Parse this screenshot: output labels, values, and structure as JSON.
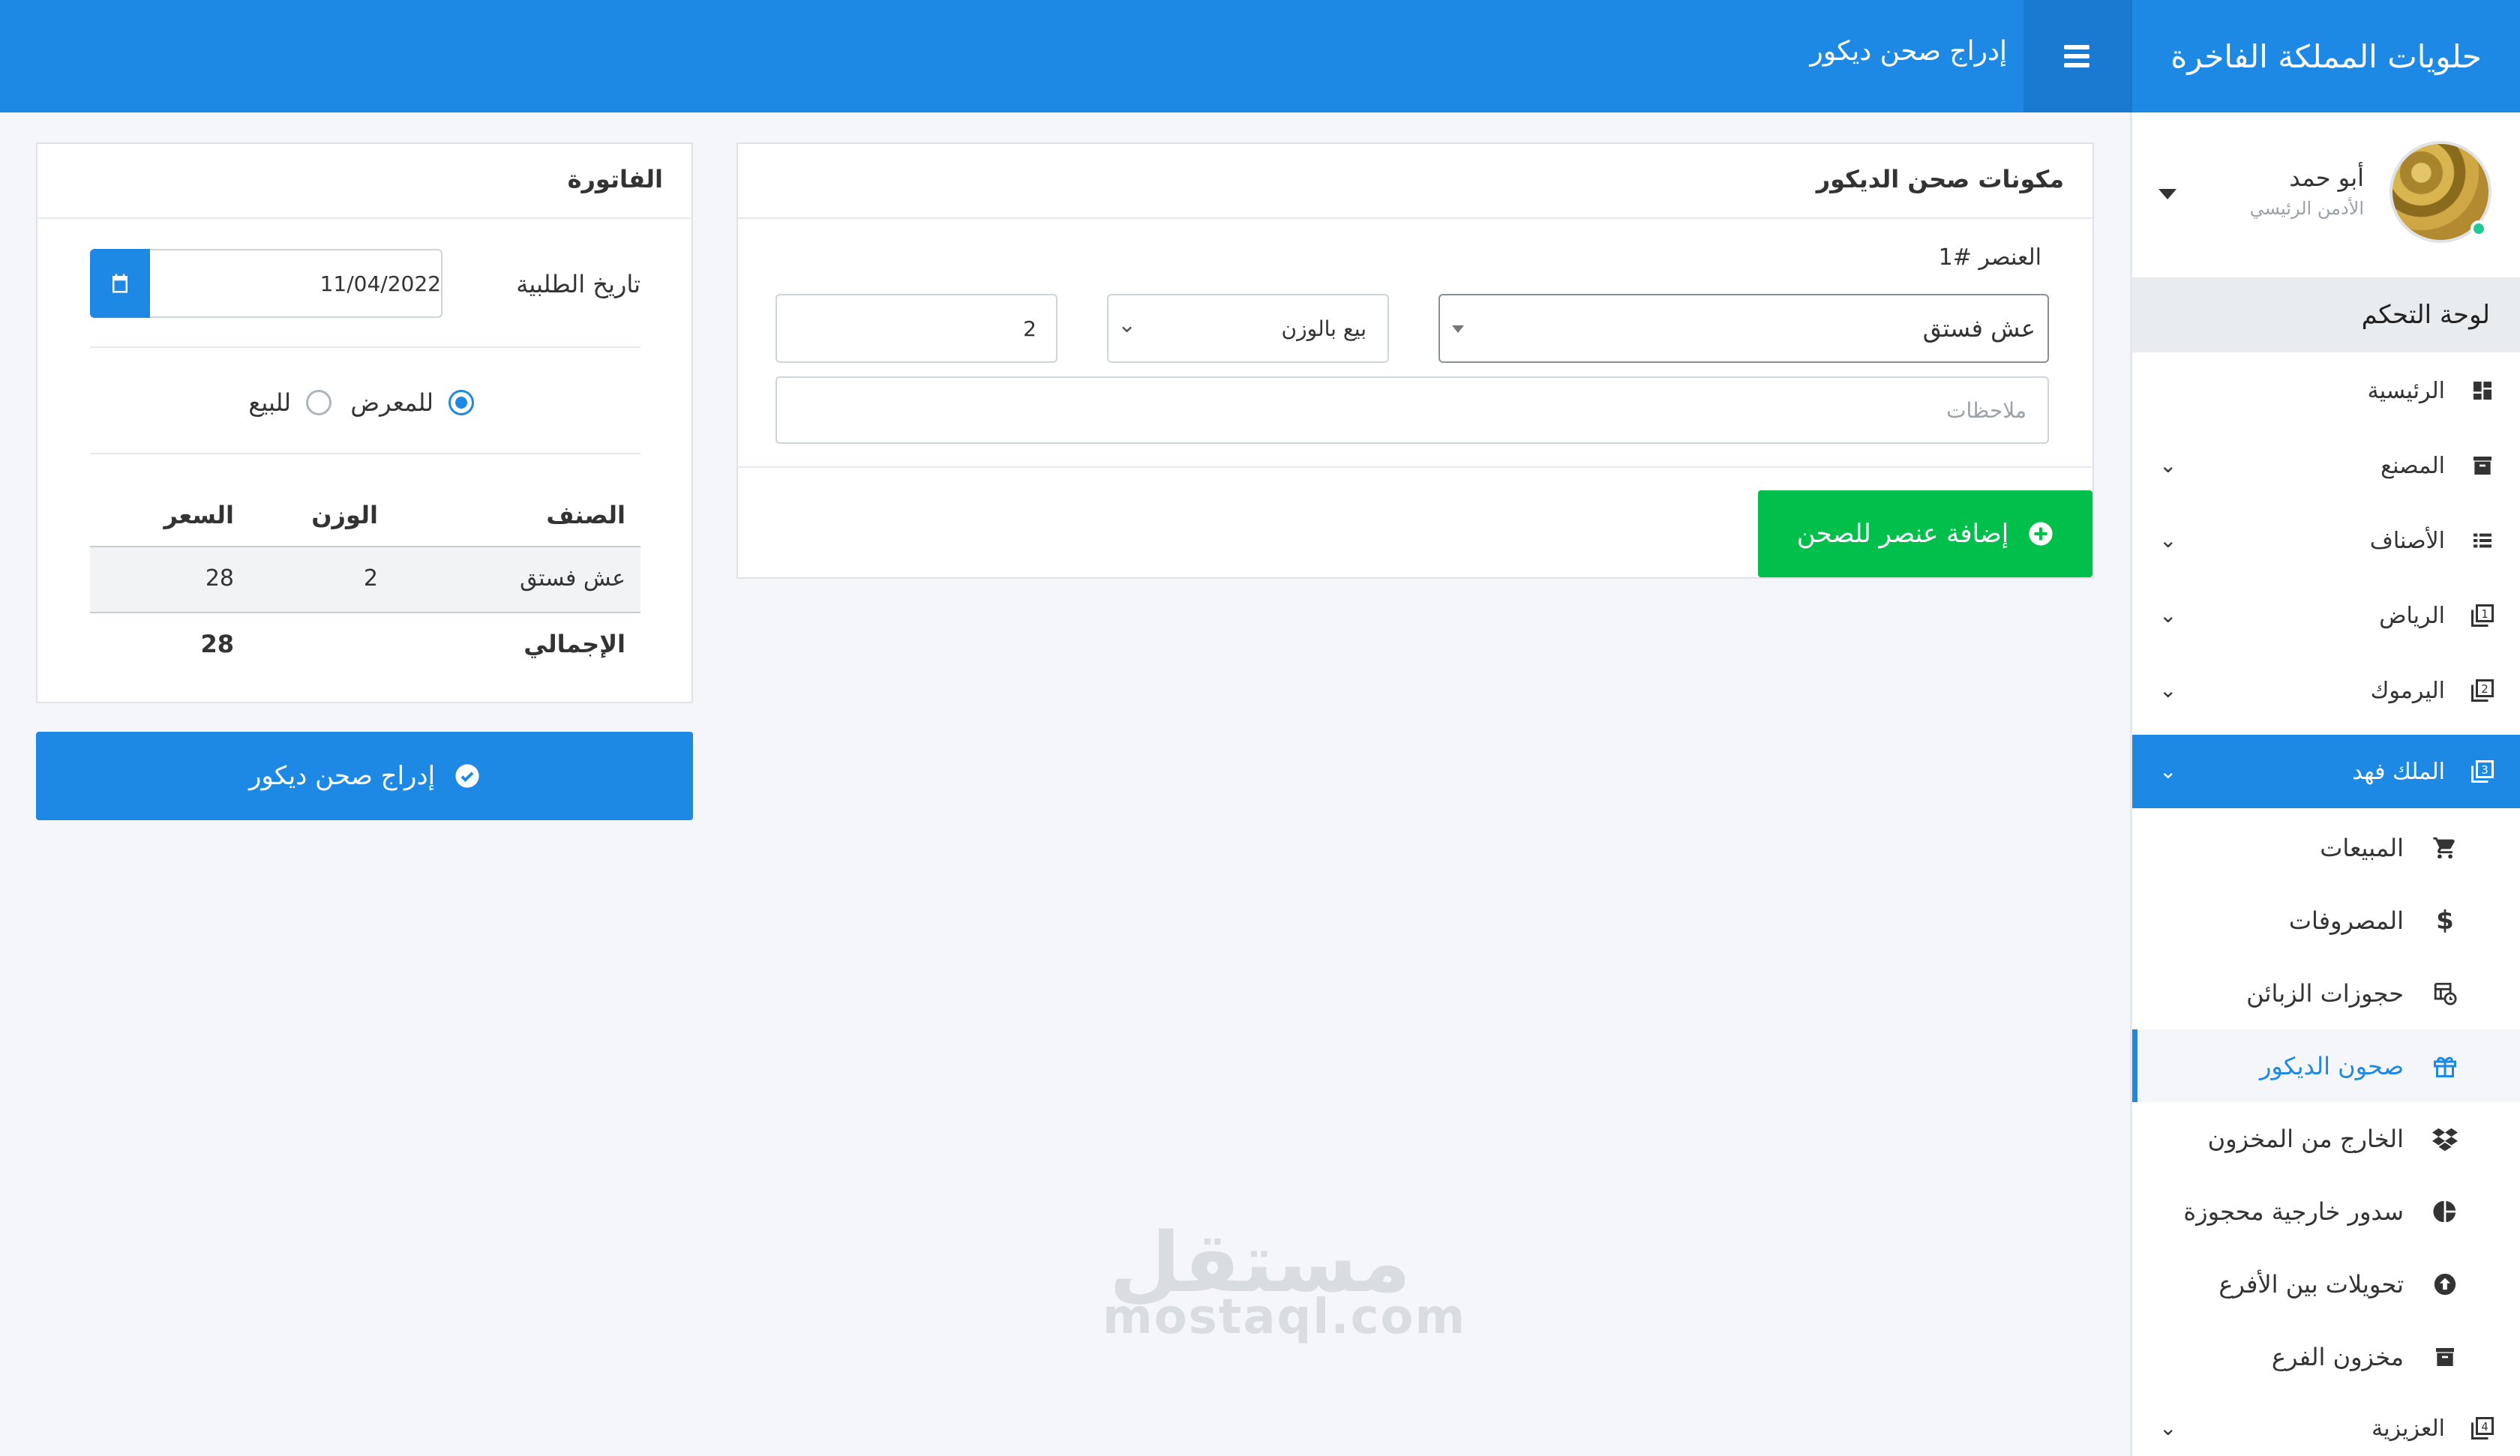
{
  "topbar": {
    "brand": "حلويات المملكة الفاخرة",
    "page_title": "إدراج صحن ديكور",
    "menu_icon": "hamburger-icon"
  },
  "user": {
    "name": "أبو حمد",
    "role": "الأدمن الرئيسي"
  },
  "sidebar": {
    "header": "لوحة التحكم",
    "items": [
      {
        "label": "الرئيسية",
        "icon": "dashboard-icon",
        "expandable": false
      },
      {
        "label": "المصنع",
        "icon": "archive-icon",
        "expandable": true
      },
      {
        "label": "الأصناف",
        "icon": "list-icon",
        "expandable": true
      },
      {
        "label": "الرياض",
        "icon": "filter-1-icon",
        "expandable": true
      },
      {
        "label": "اليرموك",
        "icon": "filter-2-icon",
        "expandable": true
      },
      {
        "label": "الملك فهد",
        "icon": "filter-3-icon",
        "expandable": true,
        "active": true
      },
      {
        "label": "العزيزية",
        "icon": "filter-4-icon",
        "expandable": true
      }
    ],
    "sub_items": [
      {
        "label": "المبيعات",
        "icon": "cart-icon"
      },
      {
        "label": "المصروفات",
        "icon": "dollar-icon"
      },
      {
        "label": "حجوزات الزبائن",
        "icon": "table-clock-icon"
      },
      {
        "label": "صحون الديكور",
        "icon": "gift-icon",
        "current": true
      },
      {
        "label": "الخارج من المخزون",
        "icon": "dropbox-icon"
      },
      {
        "label": "سدور خارجية محجوزة",
        "icon": "pie-chart-icon"
      },
      {
        "label": "تحويلات بين الأفرع",
        "icon": "upload-circle-icon"
      },
      {
        "label": "مخزون الفرع",
        "icon": "archive-icon"
      }
    ]
  },
  "components": {
    "title": "مكونات صحن الديكور",
    "item_label": "العنصر #1",
    "item_select": "عش فستق",
    "sale_type": "بيع بالوزن",
    "weight": "2",
    "notes_placeholder": "ملاحظات",
    "add_button": "إضافة عنصر للصحن"
  },
  "invoice": {
    "title": "الفاتورة",
    "date_label": "تاريخ الطلبية",
    "date_value": "11/04/2022",
    "radio_display": "للمعرض",
    "radio_sale": "للبيع",
    "columns": [
      "الصنف",
      "الوزن",
      "السعر"
    ],
    "rows": [
      {
        "item": "عش فستق",
        "weight": "2",
        "price": "28"
      }
    ],
    "total_label": "الإجمالي",
    "total_value": "28",
    "submit_button": "إدراج صحن ديكور"
  },
  "watermark": {
    "arabic": "مستقل",
    "latin": "mostaql.com"
  }
}
